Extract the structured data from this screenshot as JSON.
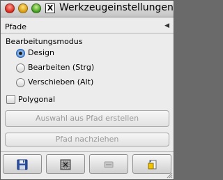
{
  "window": {
    "title": "Werkzeugeinstellungen"
  },
  "panel": {
    "header": "Pfade"
  },
  "mode": {
    "title": "Bearbeitungsmodus",
    "options": [
      {
        "label": "Design",
        "checked": true
      },
      {
        "label": "Bearbeiten (Strg)",
        "checked": false
      },
      {
        "label": "Verschieben (Alt)",
        "checked": false
      }
    ]
  },
  "polygonal": {
    "label": "Polygonal",
    "checked": false
  },
  "buttons": {
    "selection_from_path": "Auswahl aus Pfad erstellen",
    "stroke_path": "Pfad nachziehen"
  },
  "toolbar": {
    "icons": [
      "save-icon",
      "restore-icon",
      "delete-icon",
      "reset-icon"
    ]
  }
}
